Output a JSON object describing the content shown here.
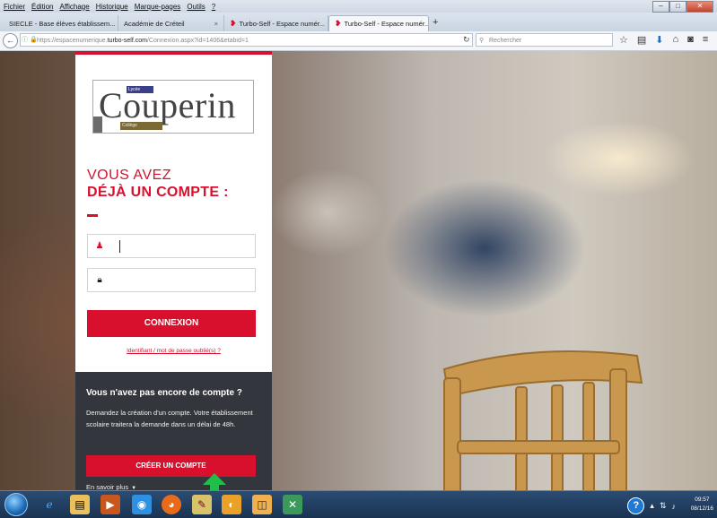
{
  "browser": {
    "menu": [
      "Fichier",
      "Édition",
      "Affichage",
      "Historique",
      "Marque-pages",
      "Outils",
      "?"
    ],
    "tabs": [
      {
        "label": "SIECLE - Base élèves établissem..."
      },
      {
        "label": "Académie de Créteil"
      },
      {
        "label": "Turbo-Self - Espace numér..."
      },
      {
        "label": "Turbo-Self - Espace numér..."
      }
    ],
    "url_prefix": "https://espacenumerique.",
    "url_domain": "turbo-self.com",
    "url_path": "/Connexion.aspx?id=1406&etabid=1",
    "search_placeholder": "Rechercher",
    "new_tab": "+"
  },
  "logo": {
    "name": "Couperin",
    "lycee": "Lycée",
    "college": "Collège"
  },
  "login": {
    "heading_line1": "VOUS AVEZ",
    "heading_line2": "DÉJÀ UN COMPTE :",
    "submit_label": "CONNEXION",
    "forgot_link": "Identifiant / mot de passe oublié(s) ?"
  },
  "signup": {
    "title": "Vous n'avez pas encore de compte ?",
    "text": "Demandez la création d'un compte. Votre établissement scolaire traitera la demande dans un délai de 48h.",
    "button": "CRÉER UN COMPTE",
    "more": "En savoir plus"
  },
  "taskbar": {
    "time": "09:57",
    "date": "08/12/16",
    "help": "?"
  },
  "colors": {
    "accent": "#d8102e",
    "dark_panel": "#33363c"
  }
}
